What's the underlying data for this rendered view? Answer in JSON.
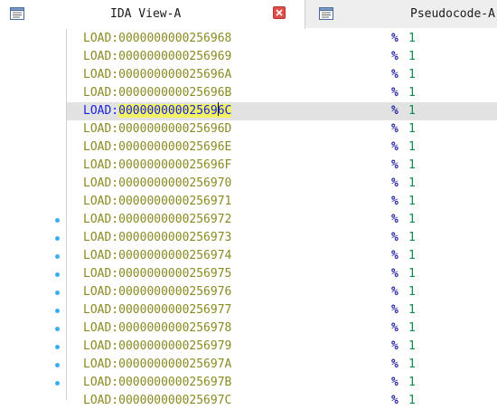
{
  "tabs": [
    {
      "label": "IDA View-A",
      "icon": "listing-view-icon",
      "active": true
    },
    {
      "label": "Pseudocode-A",
      "icon": "pseudocode-view-icon",
      "active": false
    }
  ],
  "rows": [
    {
      "segment": "LOAD:",
      "address": "0000000000256968",
      "directive": "%",
      "value": "1",
      "breakpoint": false
    },
    {
      "segment": "LOAD:",
      "address": "0000000000256969",
      "directive": "%",
      "value": "1",
      "breakpoint": false
    },
    {
      "segment": "LOAD:",
      "address": "000000000025696A",
      "directive": "%",
      "value": "1",
      "breakpoint": false
    },
    {
      "segment": "LOAD:",
      "address": "000000000025696B",
      "directive": "%",
      "value": "1",
      "breakpoint": false
    },
    {
      "segment": "LOAD:",
      "address": "000000000025696C",
      "directive": "%",
      "value": "1",
      "breakpoint": false,
      "current": true,
      "address_before_caret": "00000000002569",
      "address_after_caret": "6C"
    },
    {
      "segment": "LOAD:",
      "address": "000000000025696D",
      "directive": "%",
      "value": "1",
      "breakpoint": false
    },
    {
      "segment": "LOAD:",
      "address": "000000000025696E",
      "directive": "%",
      "value": "1",
      "breakpoint": false
    },
    {
      "segment": "LOAD:",
      "address": "000000000025696F",
      "directive": "%",
      "value": "1",
      "breakpoint": false
    },
    {
      "segment": "LOAD:",
      "address": "0000000000256970",
      "directive": "%",
      "value": "1",
      "breakpoint": false
    },
    {
      "segment": "LOAD:",
      "address": "0000000000256971",
      "directive": "%",
      "value": "1",
      "breakpoint": false
    },
    {
      "segment": "LOAD:",
      "address": "0000000000256972",
      "directive": "%",
      "value": "1",
      "breakpoint": true
    },
    {
      "segment": "LOAD:",
      "address": "0000000000256973",
      "directive": "%",
      "value": "1",
      "breakpoint": true
    },
    {
      "segment": "LOAD:",
      "address": "0000000000256974",
      "directive": "%",
      "value": "1",
      "breakpoint": true
    },
    {
      "segment": "LOAD:",
      "address": "0000000000256975",
      "directive": "%",
      "value": "1",
      "breakpoint": true
    },
    {
      "segment": "LOAD:",
      "address": "0000000000256976",
      "directive": "%",
      "value": "1",
      "breakpoint": true
    },
    {
      "segment": "LOAD:",
      "address": "0000000000256977",
      "directive": "%",
      "value": "1",
      "breakpoint": true
    },
    {
      "segment": "LOAD:",
      "address": "0000000000256978",
      "directive": "%",
      "value": "1",
      "breakpoint": true
    },
    {
      "segment": "LOAD:",
      "address": "0000000000256979",
      "directive": "%",
      "value": "1",
      "breakpoint": true
    },
    {
      "segment": "LOAD:",
      "address": "000000000025697A",
      "directive": "%",
      "value": "1",
      "breakpoint": true
    },
    {
      "segment": "LOAD:",
      "address": "000000000025697B",
      "directive": "%",
      "value": "1",
      "breakpoint": true
    },
    {
      "segment": "LOAD:",
      "address": "000000000025697C",
      "directive": "%",
      "value": "1",
      "breakpoint": false
    }
  ],
  "colors": {
    "segment": "#8a8a22",
    "current_segment": "#1a22e0",
    "address_highlight": "#f2f266",
    "current_line": "#e2e2e2",
    "directive": "#2a2aa6",
    "value": "#0c8c4c",
    "breakpoint_dot": "#3aaef0",
    "close_button": "#e0504a"
  }
}
